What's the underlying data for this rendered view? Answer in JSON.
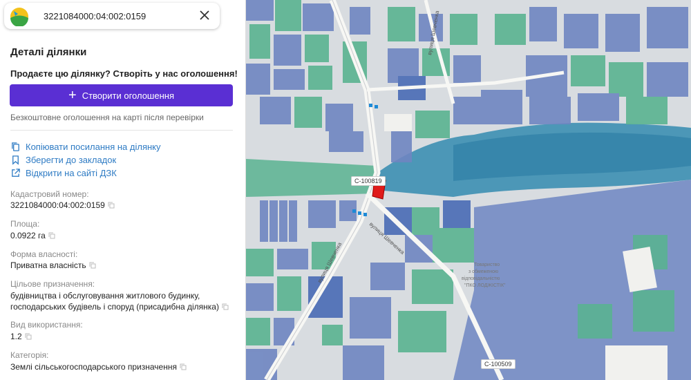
{
  "search": {
    "query": "3221084000:04:002:0159"
  },
  "details": {
    "title": "Деталі ділянки",
    "promo": "Продаєте цю ділянку? Створіть у нас оголошення!",
    "cta_label": "Створити оголошення",
    "free_note": "Безкоштовне оголошення на карті після перевірки"
  },
  "links": {
    "copy": "Копіювати посилання на ділянку",
    "bookmark": "Зберегти до закладок",
    "dzk": "Відкрити на сайті ДЗК"
  },
  "fields": {
    "cadastral_label": "Кадастровий номер:",
    "cadastral_value": "3221084000:04:002:0159",
    "area_label": "Площа:",
    "area_value": "0.0922 га",
    "ownership_label": "Форма власності:",
    "ownership_value": "Приватна власність",
    "purpose_label": "Цільове призначення:",
    "purpose_line1": "будівництва і обслуговування житлового будинку,",
    "purpose_line2": "господарських будівель і споруд (присадибна ділянка)",
    "usage_label": "Вид використання:",
    "usage_value": "1.2",
    "category_label": "Категорія:",
    "category_value": "Землі сільськогосподарського призначення"
  },
  "map": {
    "road_label_1": "С-100819",
    "road_label_2": "С-100509",
    "street_1": "вулиця Шевченка",
    "street_2": "вулиця Шевченка",
    "street_3": "вулиця Шевченка",
    "org_label_line1": "Товариство",
    "org_label_line2": "з обмеженою",
    "org_label_line3": "відповідальністю",
    "org_label_line4": "\"ПКО ЛОДЖІСТІК\"",
    "colors": {
      "accent": "#5a2fd3",
      "link": "#2e7bc4",
      "parcel_blue": "#6f86c2",
      "parcel_green": "#5ab391",
      "water": "#3d8fb3",
      "selected": "#e01b1b"
    }
  }
}
